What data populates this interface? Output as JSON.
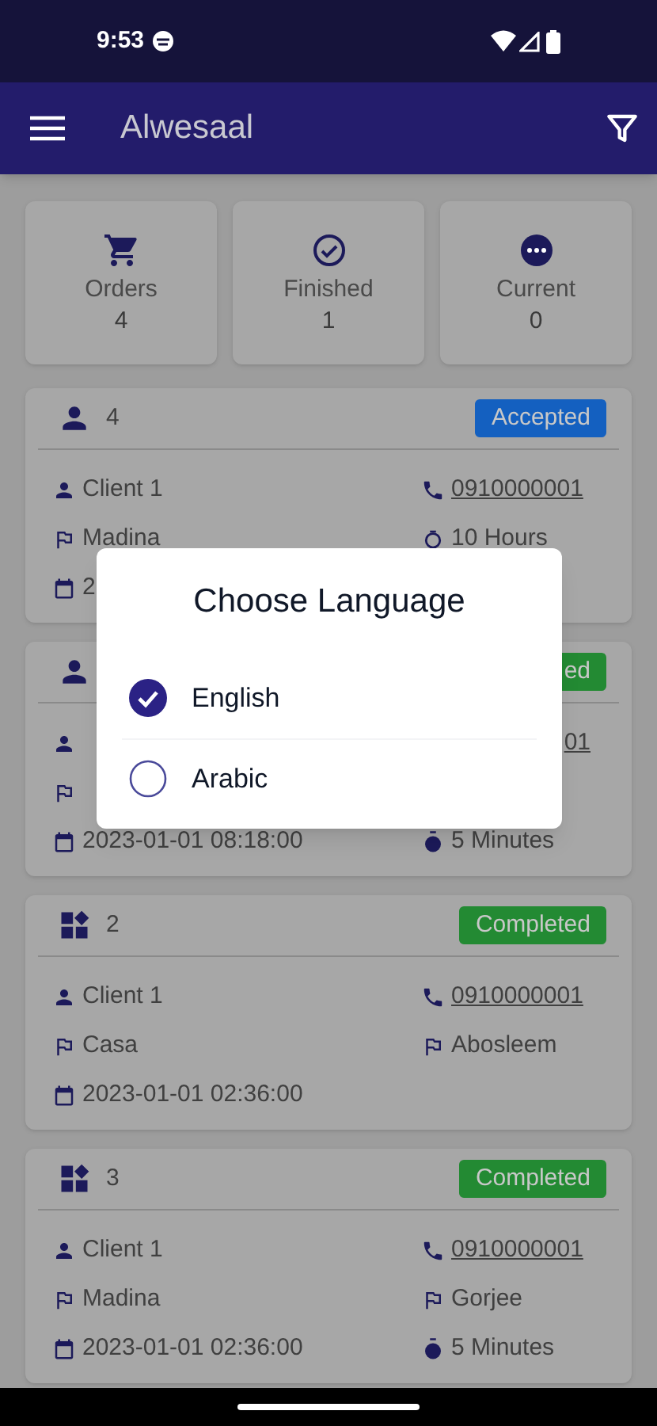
{
  "status_bar": {
    "time": "9:53"
  },
  "app_bar": {
    "title": "Alwesaal"
  },
  "stats": [
    {
      "kind": "cart",
      "label": "Orders",
      "value": "4"
    },
    {
      "kind": "check",
      "label": "Finished",
      "value": "1"
    },
    {
      "kind": "more",
      "label": "Current",
      "value": "0"
    }
  ],
  "orders": [
    {
      "kind": "person",
      "number": "4",
      "status": "Accepted",
      "color": "#1460c0",
      "rows": [
        {
          "left": {
            "kind": "client",
            "text": "Client 1"
          },
          "right": {
            "kind": "phone",
            "text": "0910000001"
          }
        },
        {
          "left": {
            "kind": "location",
            "text": "Madina"
          },
          "right": {
            "kind": "clock",
            "text": "10 Hours"
          }
        },
        {
          "left": {
            "kind": "date",
            "text": "2"
          }
        }
      ]
    },
    {
      "kind": "person",
      "status": "ed",
      "color": "#238a33",
      "rows": [
        {
          "left": {
            "kind": "client"
          },
          "right": {
            "text": "01"
          }
        },
        {
          "left": {
            "kind": "location"
          }
        },
        {
          "left": {
            "kind": "date",
            "text": "2023-01-01 08:18:00"
          },
          "right": {
            "kind": "timer",
            "text": "5 Minutes"
          }
        }
      ]
    },
    {
      "kind": "apps",
      "number": "2",
      "status": "Completed",
      "color": "#238a33",
      "rows": [
        {
          "left": {
            "kind": "client",
            "text": "Client 1"
          },
          "right": {
            "kind": "phone",
            "text": "0910000001"
          }
        },
        {
          "left": {
            "kind": "location",
            "text": "Casa"
          },
          "right": {
            "kind": "location",
            "text": "Abosleem"
          }
        },
        {
          "left": {
            "kind": "date",
            "text": "2023-01-01 02:36:00"
          }
        }
      ]
    },
    {
      "kind": "apps",
      "number": "3",
      "status": "Completed",
      "color": "#238a33",
      "rows": [
        {
          "left": {
            "kind": "client",
            "text": "Client 1"
          },
          "right": {
            "kind": "phone",
            "text": "0910000001"
          }
        },
        {
          "left": {
            "kind": "location",
            "text": "Madina"
          },
          "right": {
            "kind": "location",
            "text": "Gorjee"
          }
        },
        {
          "left": {
            "kind": "date",
            "text": "2023-01-01 02:36:00"
          },
          "right": {
            "kind": "timer",
            "text": "5 Minutes"
          }
        }
      ]
    }
  ],
  "dialog": {
    "title": "Choose Language",
    "options": [
      {
        "label": "English",
        "selected": true
      },
      {
        "label": "Arabic",
        "selected": false
      }
    ]
  }
}
